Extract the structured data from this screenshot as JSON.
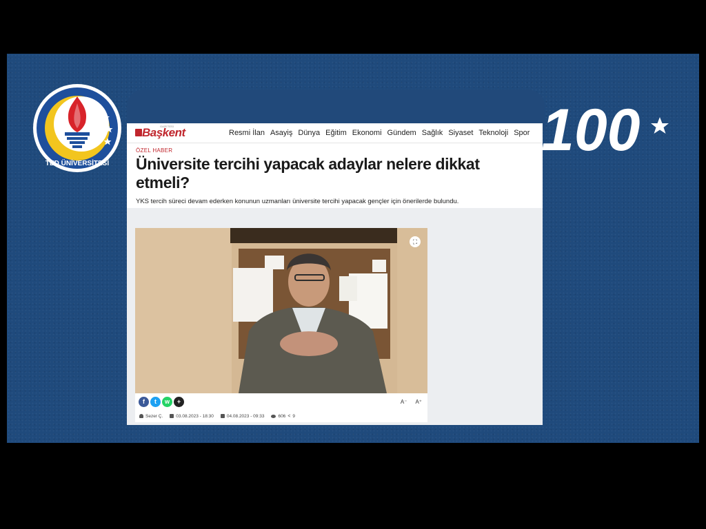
{
  "logo": {
    "text": "TED ÜNİVERSİTESİ",
    "icon": "torch-icon",
    "colors": {
      "ring": "#1e4f9c",
      "crescent": "#f2c51e",
      "flame": "#d8232a"
    }
  },
  "centennial": {
    "text": "100",
    "icon": "crescent-star-icon"
  },
  "site": {
    "brand": "Başkent",
    "brand_tagline": "GAZETESİ",
    "nav": [
      "Resmi İlan",
      "Asayiş",
      "Dünya",
      "Eğitim",
      "Ekonomi",
      "Gündem",
      "Sağlık",
      "Siyaset",
      "Teknoloji",
      "Spor"
    ]
  },
  "article": {
    "kicker": "ÖZEL HABER",
    "title": "Üniversite tercihi yapacak adaylar nelere dikkat etmeli?",
    "summary": "YKS tercih süreci devam ederken konunun uzmanları üniversite tercihi yapacak gençler için önerilerde bulundu.",
    "author": "Sezer Ç.",
    "published": "03.08.2023 - 18:30",
    "updated": "04.08.2023 - 09:33",
    "views": "606",
    "shares": "9"
  },
  "share": {
    "facebook": "f",
    "twitter": "t",
    "whatsapp": "w",
    "more": "+"
  },
  "font_controls": {
    "decrease": "A⁻",
    "increase": "A⁺"
  },
  "colors": {
    "slide_bg": "#1f4a7c",
    "accent": "#c0262d"
  }
}
